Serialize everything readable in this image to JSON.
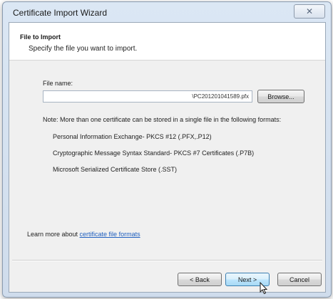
{
  "window": {
    "title": "Certificate Import Wizard",
    "close_glyph": "✕"
  },
  "header": {
    "title": "File to Import",
    "subtitle": "Specify the file you want to import."
  },
  "file_name": {
    "label": "File name:",
    "value": "\\PC201201041589.pfx"
  },
  "browse_label": "Browse...",
  "note": {
    "text": "Note: More than one certificate can be stored in a single file in the following formats:",
    "formats": [
      "Personal Information Exchange- PKCS #12 (.PFX,.P12)",
      "Cryptographic Message Syntax Standard- PKCS #7 Certificates (.P7B)",
      "Microsoft Serialized Certificate Store (.SST)"
    ]
  },
  "learn_more": {
    "prefix": "Learn more about ",
    "link": "certificate file formats"
  },
  "footer": {
    "back_label": "< Back",
    "next_label": "Next >",
    "cancel_label": "Cancel"
  }
}
